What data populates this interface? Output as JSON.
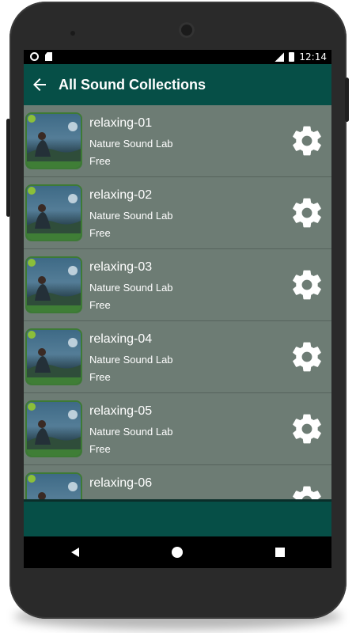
{
  "status_bar": {
    "time": "12:14"
  },
  "app_bar": {
    "title": "All Sound Collections",
    "back_icon": "arrow-left-icon",
    "color": "#064f47"
  },
  "list": {
    "background": "#6d7c74",
    "items": [
      {
        "title": "relaxing-01",
        "author": "Nature Sound Lab",
        "price": "Free"
      },
      {
        "title": "relaxing-02",
        "author": "Nature Sound Lab",
        "price": "Free"
      },
      {
        "title": "relaxing-03",
        "author": "Nature Sound Lab",
        "price": "Free"
      },
      {
        "title": "relaxing-04",
        "author": "Nature Sound Lab",
        "price": "Free"
      },
      {
        "title": "relaxing-05",
        "author": "Nature Sound Lab",
        "price": "Free"
      },
      {
        "title": "relaxing-06"
      }
    ],
    "item_action_icon": "gear-icon"
  },
  "nav_bar": {
    "back": "triangle-back-icon",
    "home": "circle-home-icon",
    "recents": "square-recents-icon"
  }
}
